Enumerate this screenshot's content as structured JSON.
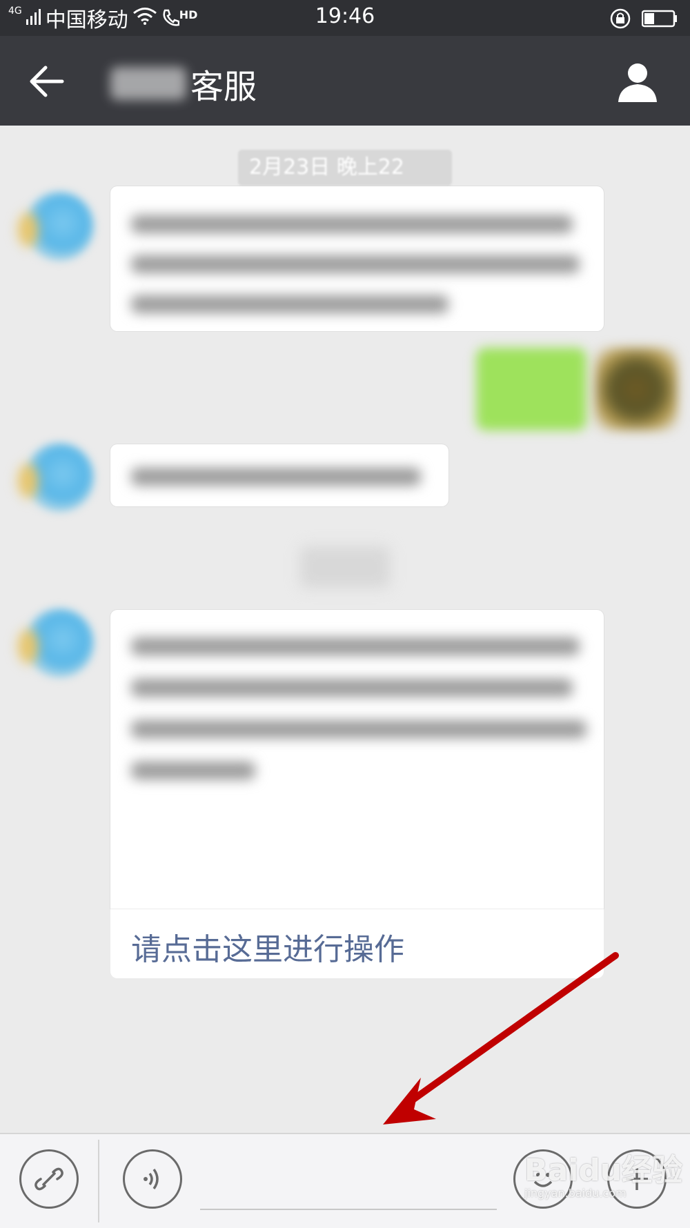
{
  "statusbar": {
    "network_type": "4G",
    "carrier": "中国移动",
    "hd_label": "HD",
    "time": "19:46"
  },
  "titlebar": {
    "title": "客服"
  },
  "chat": {
    "timestamp": "2月23日 晚上22",
    "link_text": "请点击这里进行操作"
  },
  "watermark": {
    "brand": "Baidu经验",
    "url": "jingyan.baidu.com"
  },
  "colors": {
    "titlebar_bg": "#393a3f",
    "link": "#576b95",
    "arrow": "#c00000",
    "sent_bubble": "#9ee25c"
  }
}
